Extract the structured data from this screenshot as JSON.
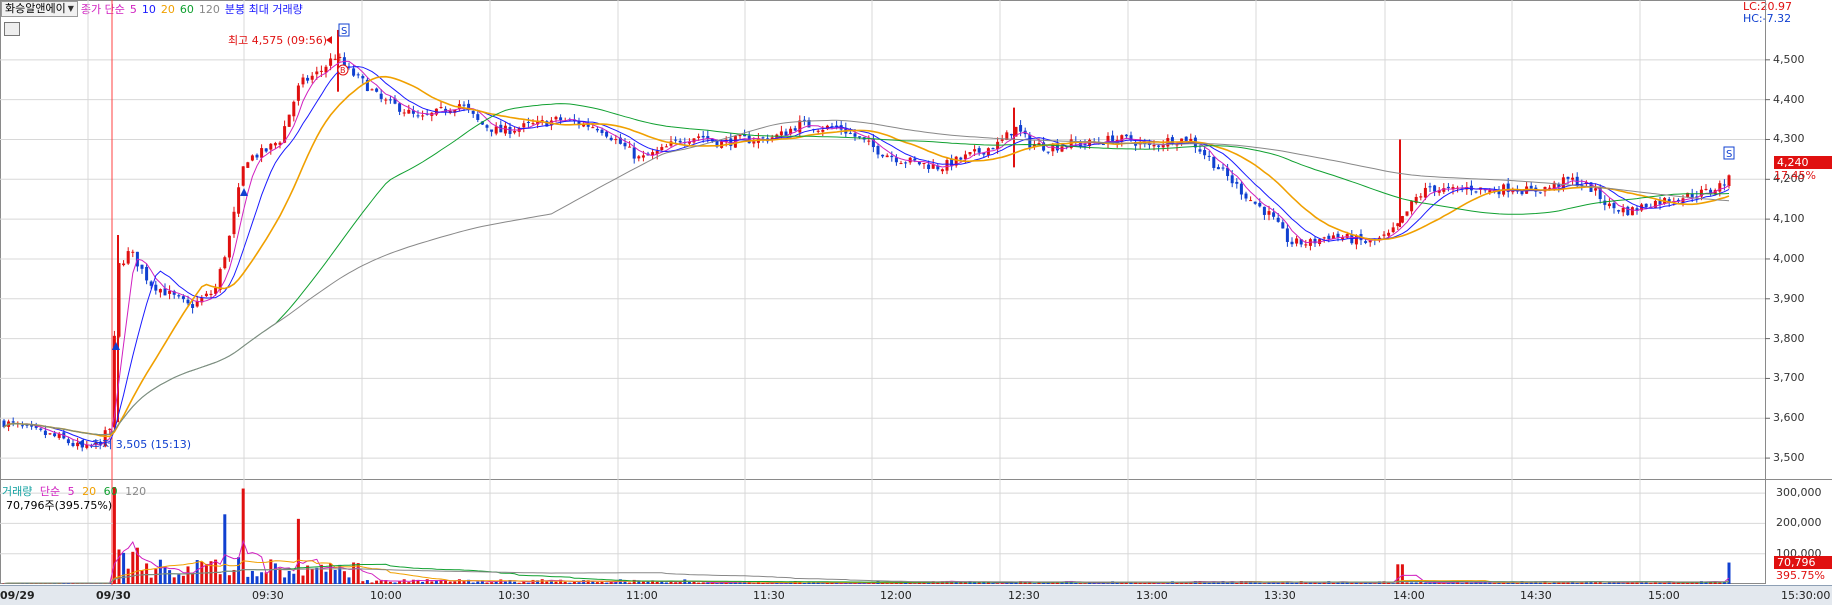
{
  "header": {
    "stock_name": "화승알앤에이",
    "indicator_prefix": "종가 단순",
    "ma_periods": [
      "5",
      "10",
      "20",
      "60",
      "120"
    ],
    "ma_colors": [
      "#d020c0",
      "#1a1aff",
      "#f0a000",
      "#10a030",
      "#888888"
    ],
    "overlay_label": "분봉 최대 거래량",
    "lc": "LC:20.97",
    "hc": "HC:-7.32"
  },
  "price_axis": {
    "ticks": [
      "4,500",
      "4,400",
      "4,300",
      "4,200",
      "4,100",
      "4,000",
      "3,900",
      "3,800",
      "3,700",
      "3,600",
      "3,500"
    ],
    "current_price": "4,240",
    "current_change": "17.45%"
  },
  "annotations": {
    "high": "최고 4,575 (09:56)",
    "low": "최저 3,505 (15:13)",
    "signal_s": "S",
    "signal_b": "B"
  },
  "volume_panel": {
    "title": "거래량",
    "prefix": "단순",
    "periods": [
      "5",
      "20",
      "60",
      "120"
    ],
    "period_colors": [
      "#d020c0",
      "#f0a000",
      "#10a030",
      "#888888"
    ],
    "current": "70,796주(395.75%)",
    "ticks": [
      "300,000",
      "200,000",
      "100,000"
    ],
    "current_volume": "70,796",
    "current_pct": "395.75%"
  },
  "time_axis": {
    "labels": [
      "09/29",
      "09/30",
      "09:30",
      "10:00",
      "10:30",
      "11:00",
      "11:30",
      "12:00",
      "12:30",
      "13:00",
      "13:30",
      "14:00",
      "14:30",
      "15:00",
      "15:30:00"
    ]
  },
  "chart_data": {
    "type": "candlestick",
    "ylim": [
      3450,
      4600
    ],
    "high": 4575,
    "low": 3505,
    "last": 4240,
    "ma_series": [
      "5",
      "10",
      "20",
      "60",
      "120"
    ],
    "volume_ylim": [
      0,
      330000
    ]
  },
  "colors": {
    "up": "#e01010",
    "down": "#1040d0",
    "grid": "#d8d8d8",
    "ref_line": "#ff4040"
  }
}
